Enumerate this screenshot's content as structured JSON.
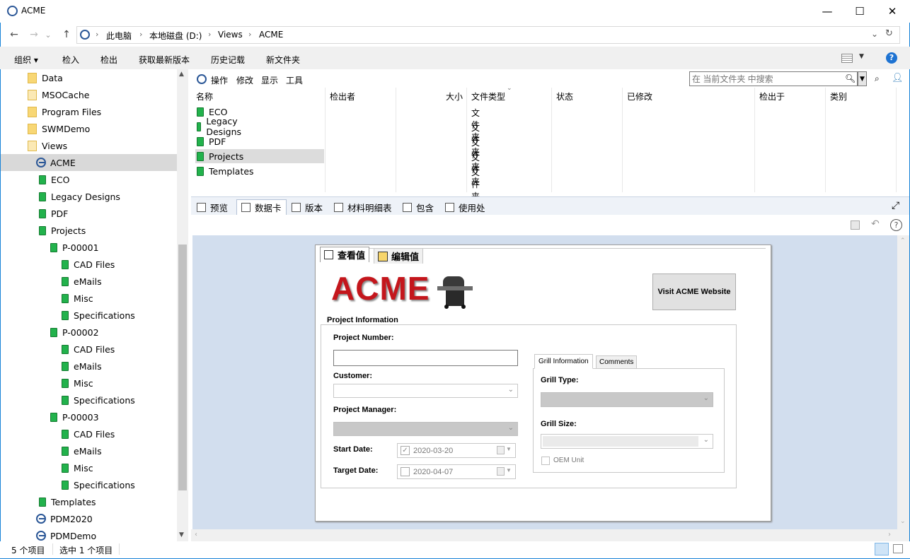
{
  "window": {
    "title": "ACME",
    "minimize": "—",
    "maximize": "☐",
    "close": "✕"
  },
  "address": {
    "back": "←",
    "forward": "→",
    "recent": "⌄",
    "up": "↑",
    "crumbs": [
      "此电脑",
      "本地磁盘 (D:)",
      "Views",
      "ACME"
    ],
    "separator": "›",
    "dropdown": "⌄",
    "refresh": "↻"
  },
  "commandbar": {
    "organize": "组织 ▾",
    "checkin": "检入",
    "checkout": "检出",
    "getlatest": "获取最新版本",
    "history": "历史记载",
    "newfolder": "新文件夹",
    "help": "?"
  },
  "sidebar": {
    "items": [
      {
        "label": "Data",
        "type": "yfolder",
        "indent": 0
      },
      {
        "label": "MSOCache",
        "type": "yfolder-pale",
        "indent": 0
      },
      {
        "label": "Program Files",
        "type": "yfolder",
        "indent": 0
      },
      {
        "label": "SWMDemo",
        "type": "yfolder",
        "indent": 0
      },
      {
        "label": "Views",
        "type": "yfolder-pale",
        "indent": 0
      },
      {
        "label": "ACME",
        "type": "vault",
        "indent": 1,
        "selected": true
      },
      {
        "label": "ECO",
        "type": "gfolder",
        "indent": 2
      },
      {
        "label": "Legacy Designs",
        "type": "gfolder",
        "indent": 2
      },
      {
        "label": "PDF",
        "type": "gfolder",
        "indent": 2
      },
      {
        "label": "Projects",
        "type": "gfolder",
        "indent": 2
      },
      {
        "label": "P-00001",
        "type": "gfolder",
        "indent": 3
      },
      {
        "label": "CAD Files",
        "type": "gfolder",
        "indent": 4
      },
      {
        "label": "eMails",
        "type": "gfolder",
        "indent": 4
      },
      {
        "label": "Misc",
        "type": "gfolder",
        "indent": 4
      },
      {
        "label": "Specifications",
        "type": "gfolder",
        "indent": 4
      },
      {
        "label": "P-00002",
        "type": "gfolder",
        "indent": 3
      },
      {
        "label": "CAD Files",
        "type": "gfolder",
        "indent": 4
      },
      {
        "label": "eMails",
        "type": "gfolder",
        "indent": 4
      },
      {
        "label": "Misc",
        "type": "gfolder",
        "indent": 4
      },
      {
        "label": "Specifications",
        "type": "gfolder",
        "indent": 4
      },
      {
        "label": "P-00003",
        "type": "gfolder",
        "indent": 3
      },
      {
        "label": "CAD Files",
        "type": "gfolder",
        "indent": 4
      },
      {
        "label": "eMails",
        "type": "gfolder",
        "indent": 4
      },
      {
        "label": "Misc",
        "type": "gfolder",
        "indent": 4
      },
      {
        "label": "Specifications",
        "type": "gfolder",
        "indent": 4
      },
      {
        "label": "Templates",
        "type": "gfolder",
        "indent": 2
      },
      {
        "label": "PDM2020",
        "type": "vault",
        "indent": 1
      },
      {
        "label": "PDMDemo",
        "type": "vault",
        "indent": 1
      }
    ]
  },
  "maintoolbar": {
    "actions": "操作",
    "modify": "修改",
    "display": "显示",
    "tools": "工具",
    "search_placeholder": "在 当前文件夹 中搜索"
  },
  "columns": {
    "name": "名称",
    "checkedby": "检出者",
    "size": "大小",
    "filetype": "文件类型",
    "state": "状态",
    "modified": "已修改",
    "checkedin": "检出于",
    "category": "类别"
  },
  "files": [
    {
      "name": "ECO",
      "type": "文件夹"
    },
    {
      "name": "Legacy Designs",
      "type": "文件夹"
    },
    {
      "name": "PDF",
      "type": "文件夹"
    },
    {
      "name": "Projects",
      "type": "文件夹",
      "selected": true
    },
    {
      "name": "Templates",
      "type": "文件夹"
    }
  ],
  "tabs": {
    "preview": "预览",
    "datacard": "数据卡",
    "version": "版本",
    "bom": "材料明细表",
    "contains": "包含",
    "whereused": "使用处"
  },
  "card": {
    "viewtab": "查看值",
    "edittab": "编辑值",
    "logo": "ACME",
    "visit_button": "Visit ACME Website",
    "group_title": "Project Information",
    "project_number_label": "Project Number:",
    "project_number_value": "",
    "customer_label": "Customer:",
    "manager_label": "Project Manager:",
    "start_label": "Start Date:",
    "start_value": "2020-03-20",
    "target_label": "Target Date:",
    "target_value": "2020-04-07",
    "subtab_grill": "Grill Information",
    "subtab_comments": "Comments",
    "grill_type_label": "Grill Type:",
    "grill_size_label": "Grill Size:",
    "oem_label": "OEM Unit"
  },
  "status": {
    "count": "5 个项目",
    "selected": "选中 1 个项目"
  }
}
